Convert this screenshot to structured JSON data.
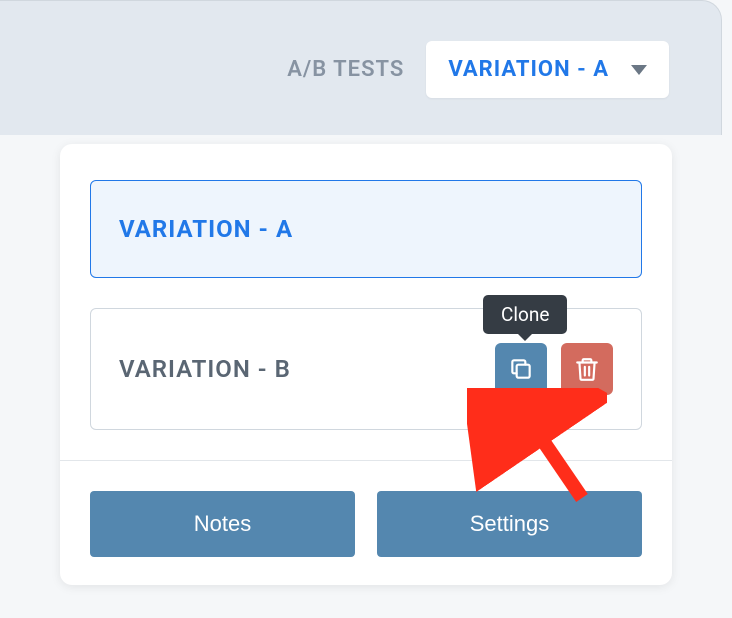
{
  "header": {
    "ab_tests_label": "A/B TESTS",
    "dropdown_label": "VARIATION - A"
  },
  "variations": [
    {
      "label": "VARIATION - A"
    },
    {
      "label": "VARIATION - B"
    }
  ],
  "tooltip": {
    "clone": "Clone"
  },
  "footer": {
    "notes": "Notes",
    "settings": "Settings"
  }
}
